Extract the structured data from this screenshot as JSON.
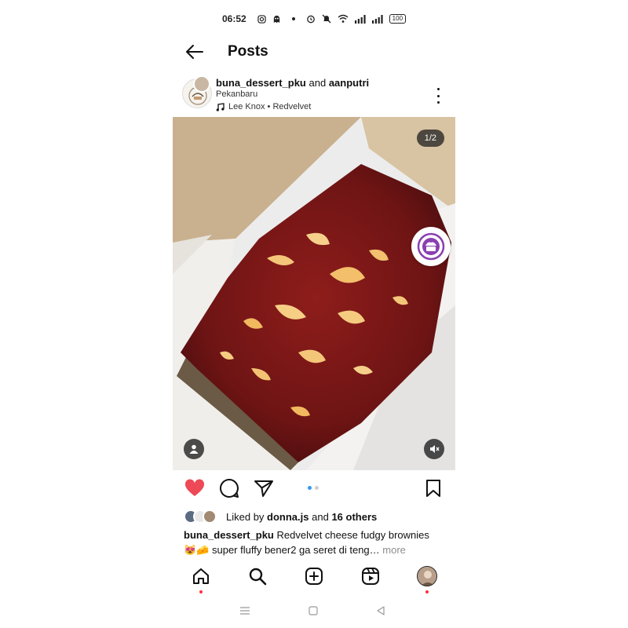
{
  "status_bar": {
    "time": "06:52",
    "battery": "100",
    "icons": [
      "instagram-icon",
      "ghost-icon",
      "alarm-icon",
      "mute-icon",
      "wifi-icon",
      "signal-icon",
      "signal-icon"
    ]
  },
  "header": {
    "title": "Posts",
    "back_icon": "arrow-left-icon"
  },
  "post": {
    "author": "buna_dessert_pku",
    "connector": "and",
    "collaborator": "aanputri",
    "location": "Pekanbaru",
    "music": "Lee Knox • Redvelvet",
    "counter": "1/2",
    "carousel_index": 0,
    "carousel_total": 2
  },
  "likes": {
    "prefix": "Liked by",
    "user": "donna.js",
    "middle": "and",
    "others": "16 others"
  },
  "caption": {
    "author": "buna_dessert_pku",
    "text": "Redvelvet cheese fudgy brownies",
    "line2": "😻🧀 super fluffy bener2 ga seret di teng…",
    "more": "more"
  },
  "colors": {
    "like_red": "#ed4956",
    "carousel_active": "#3897f0",
    "notif_dot": "#ff3040",
    "sticker_purple": "#8a3fb0"
  },
  "nav": [
    "home-icon",
    "search-icon",
    "create-icon",
    "reels-icon",
    "profile-avatar"
  ]
}
